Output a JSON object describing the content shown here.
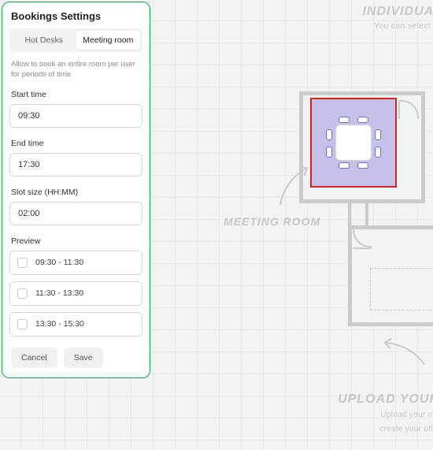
{
  "panel": {
    "title": "Bookings Settings",
    "tabs": {
      "hot": "Hot Desks",
      "meeting": "Meeting room"
    },
    "desc": "Allow to book an entire room per user for periods of time",
    "start_label": "Start time",
    "start_value": "09:30",
    "end_label": "End time",
    "end_value": "17:30",
    "slot_label": "Slot size (HH:MM)",
    "slot_value": "02:00",
    "preview_label": "Preview",
    "slots": {
      "s0": "09:30 - 11:30",
      "s1": "11:30 - 13:30",
      "s2": "13:30 - 15:30"
    },
    "cancel": "Cancel",
    "save": "Save"
  },
  "bg": {
    "individual_title": "Individual",
    "individual_sub": "You can select yo",
    "meeting_room_label": "Meeting room",
    "upload_title": "Upload your",
    "upload_sub_1": "Upload your ma",
    "upload_sub_2": "create your offic"
  }
}
